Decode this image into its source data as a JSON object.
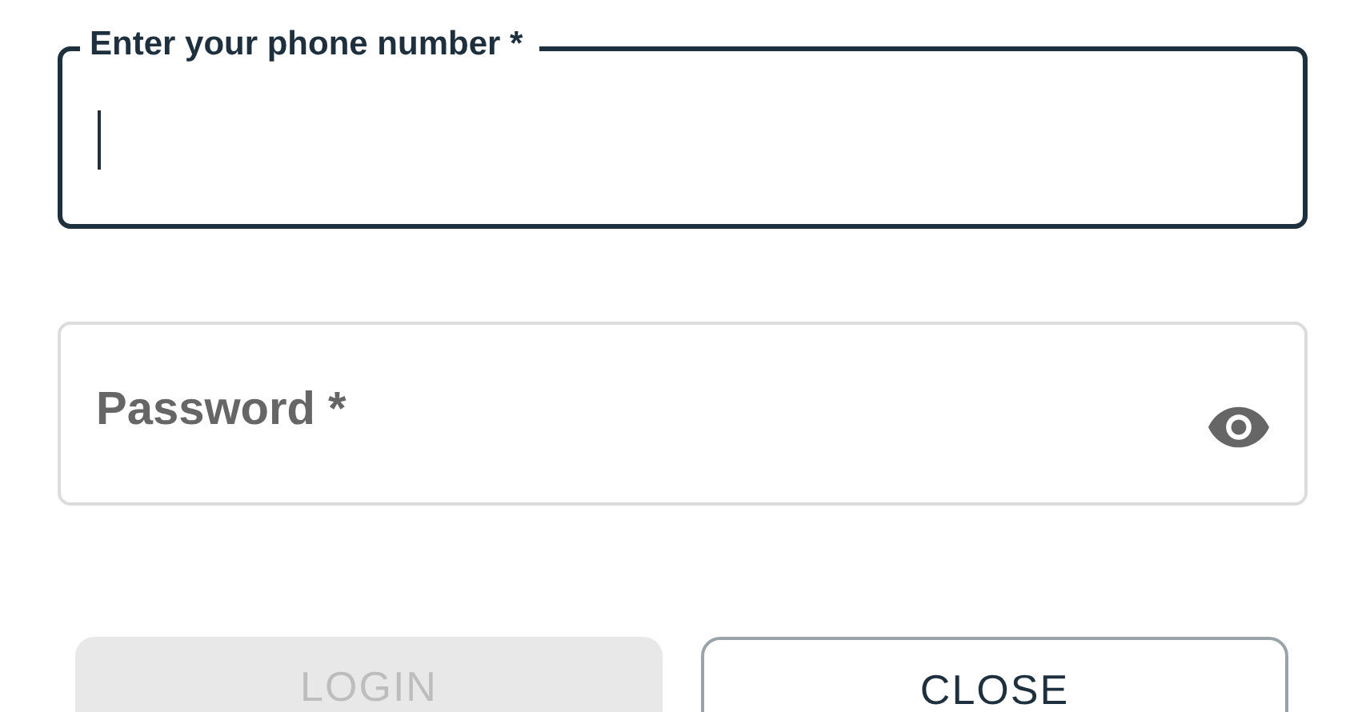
{
  "phone_field": {
    "label": "Enter your phone number *",
    "focused": true
  },
  "password_field": {
    "label": "Password *",
    "focused": false
  },
  "buttons": [
    {
      "label": "LOGIN",
      "disabled": true
    },
    {
      "label": "CLOSE",
      "disabled": false
    }
  ]
}
